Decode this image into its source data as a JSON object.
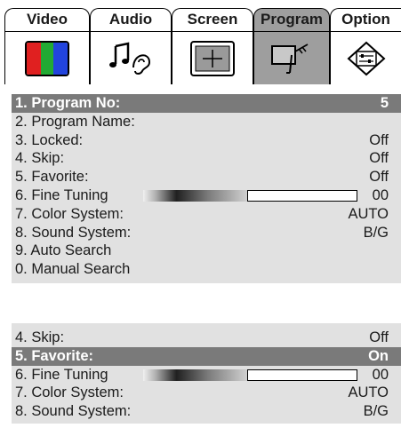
{
  "tabs": [
    {
      "label": "Video",
      "icon": "color-bars-icon",
      "active": false
    },
    {
      "label": "Audio",
      "icon": "music-note-ear-icon",
      "active": false
    },
    {
      "label": "Screen",
      "icon": "screen-crosshair-icon",
      "active": false
    },
    {
      "label": "Program",
      "icon": "tv-antenna-icon",
      "active": true
    },
    {
      "label": "Option",
      "icon": "option-sliders-icon",
      "active": false
    }
  ],
  "menu_full": {
    "items": [
      {
        "label": "1. Program No:",
        "value": "5",
        "highlighted": true
      },
      {
        "label": "2. Program Name:",
        "value": ""
      },
      {
        "label": "3. Locked:",
        "value": "Off"
      },
      {
        "label": "4. Skip:",
        "value": "Off"
      },
      {
        "label": "5. Favorite:",
        "value": "Off"
      },
      {
        "label": "6. Fine Tuning",
        "value": "00",
        "slider_level": 0.49
      },
      {
        "label": "7. Color System:",
        "value": "AUTO"
      },
      {
        "label": "8. Sound System:",
        "value": "B/G"
      },
      {
        "label": "9. Auto Search",
        "value": ""
      },
      {
        "label": "0. Manual Search",
        "value": ""
      }
    ]
  },
  "menu_partial": {
    "items": [
      {
        "label": "4. Skip:",
        "value": "Off"
      },
      {
        "label": "5. Favorite:",
        "value": "On",
        "highlighted": true
      },
      {
        "label": "6. Fine Tuning",
        "value": "00",
        "slider_level": 0.49
      },
      {
        "label": "7. Color System:",
        "value": "AUTO"
      },
      {
        "label": "8. Sound System:",
        "value": "B/G"
      }
    ]
  },
  "colors": {
    "highlight": "#7a7a7a",
    "panel": "#e1e1e1",
    "active_tab": "#9e9e9e"
  }
}
